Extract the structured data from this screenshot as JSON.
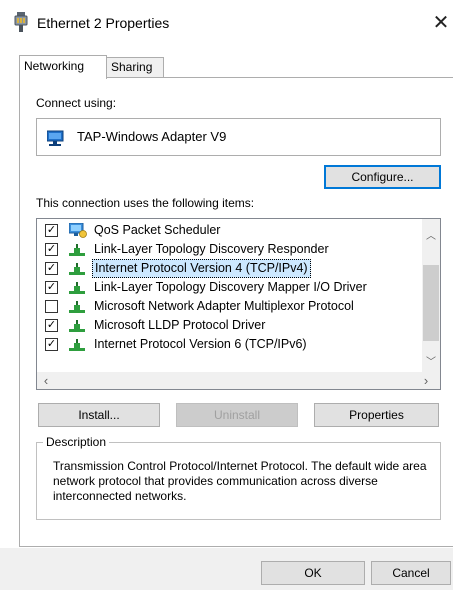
{
  "window": {
    "title": "Ethernet 2 Properties",
    "close_glyph": "✕"
  },
  "tabs": [
    {
      "label": "Networking",
      "active": true
    },
    {
      "label": "Sharing",
      "active": false
    }
  ],
  "networking": {
    "connect_using_label": "Connect using:",
    "adapter_name": "TAP-Windows Adapter V9",
    "configure_label": "Configure...",
    "items_label": "This connection uses the following items:",
    "items": [
      {
        "label": "QoS Packet Scheduler",
        "checked": true,
        "icon": "qos-scheduler-icon"
      },
      {
        "label": "Link-Layer Topology Discovery Responder",
        "checked": true,
        "icon": "network-protocol-icon"
      },
      {
        "label": "Internet Protocol Version 4 (TCP/IPv4)",
        "checked": true,
        "icon": "network-protocol-icon",
        "selected": true
      },
      {
        "label": "Link-Layer Topology Discovery Mapper I/O Driver",
        "checked": true,
        "icon": "network-protocol-icon"
      },
      {
        "label": "Microsoft Network Adapter Multiplexor Protocol",
        "checked": false,
        "icon": "network-protocol-icon"
      },
      {
        "label": "Microsoft LLDP Protocol Driver",
        "checked": true,
        "icon": "network-protocol-icon"
      },
      {
        "label": "Internet Protocol Version 6 (TCP/IPv6)",
        "checked": true,
        "icon": "network-protocol-icon"
      }
    ],
    "install_label": "Install...",
    "uninstall_label": "Uninstall",
    "properties_label": "Properties",
    "description_legend": "Description",
    "description_text": "Transmission Control Protocol/Internet Protocol. The default wide area network protocol that provides communication across diverse interconnected networks."
  },
  "footer": {
    "ok_label": "OK",
    "cancel_label": "Cancel"
  },
  "colors": {
    "selection": "#cce8ff",
    "focus_border": "#0078d7",
    "protocol_icon_green": "#2e9e3e",
    "adapter_icon_blue": "#1e6fc8"
  }
}
